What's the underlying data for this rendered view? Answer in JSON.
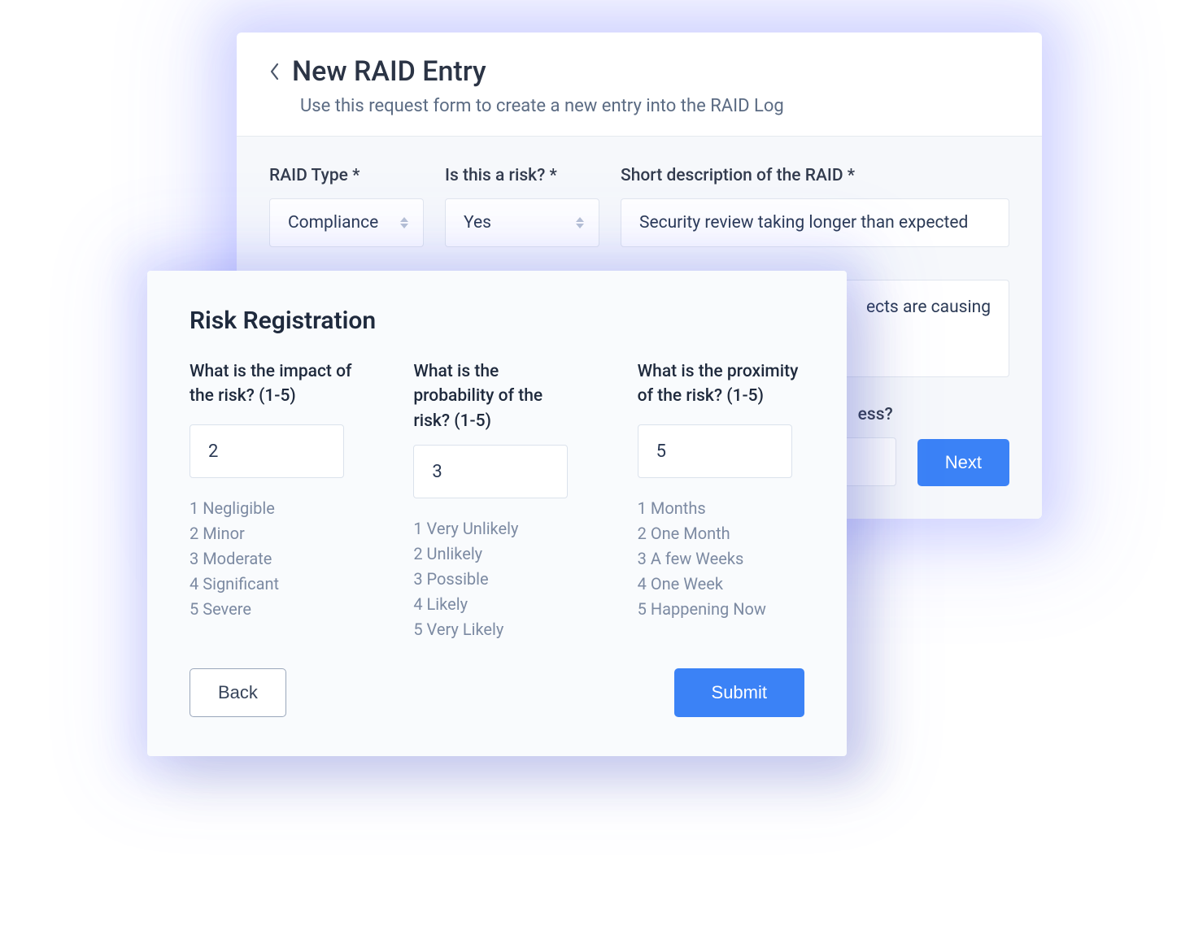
{
  "back_panel": {
    "title": "New RAID Entry",
    "subtitle": "Use this request form to create a new entry into the RAID Log",
    "fields": {
      "raid_type": {
        "label": "RAID Type *",
        "value": "Compliance"
      },
      "is_risk": {
        "label": "Is this a risk? *",
        "value": "Yes"
      },
      "short_desc": {
        "label": "Short description of the RAID *",
        "value": "Security review taking longer than expected"
      },
      "detail": {
        "value_partial": "ects are causing"
      },
      "progress": {
        "label_partial": "ess?"
      }
    },
    "next_label": "Next"
  },
  "front_panel": {
    "title": "Risk Registration",
    "impact": {
      "question": "What is the impact of the risk? (1-5)",
      "value": "2",
      "scale": [
        "1 Negligible",
        "2 Minor",
        "3 Moderate",
        "4 Significant",
        "5 Severe"
      ]
    },
    "probability": {
      "question": "What is the probability of the risk? (1-5)",
      "value": "3",
      "scale": [
        "1 Very Unlikely",
        "2 Unlikely",
        "3 Possible",
        "4 Likely",
        "5 Very Likely"
      ]
    },
    "proximity": {
      "question": "What is the proximity of the risk? (1-5)",
      "value": "5",
      "scale": [
        "1 Months",
        "2 One Month",
        "3 A few Weeks",
        "4 One Week",
        "5 Happening Now"
      ]
    },
    "back_label": "Back",
    "submit_label": "Submit"
  }
}
